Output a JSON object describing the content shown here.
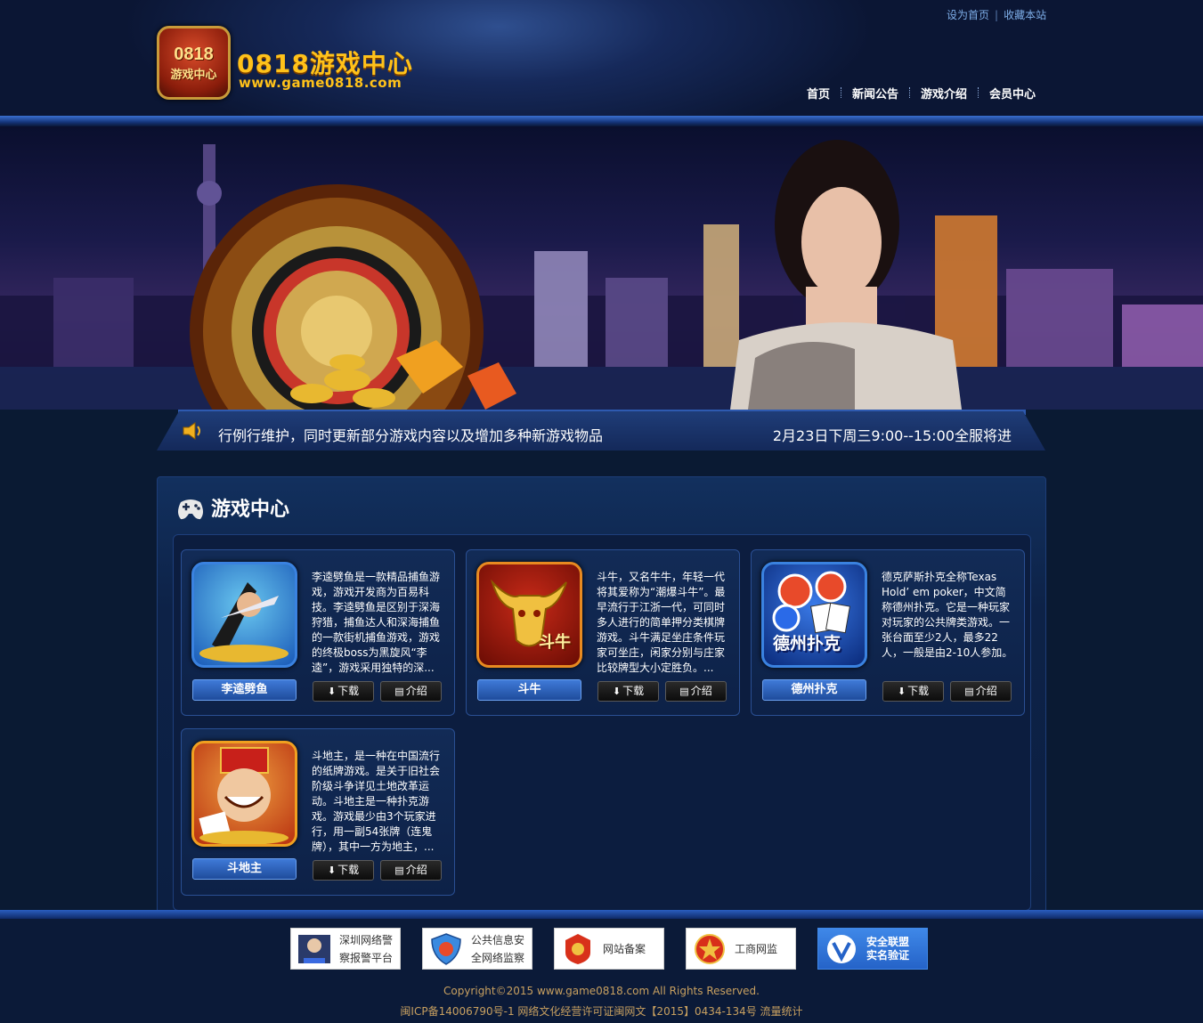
{
  "header": {
    "top_links": [
      "设为首页",
      "收藏本站"
    ],
    "logo_badge_line1": "0818",
    "logo_badge_line2": "游戏中心",
    "logo_title": "0818游戏中心",
    "logo_url": "www.game0818.com",
    "nav": [
      "首页",
      "新闻公告",
      "游戏介绍",
      "会员中心"
    ]
  },
  "notice": {
    "message": "行例行维护，同时更新部分游戏内容以及增加多种新游戏物品",
    "time": "2月23日下周三9:00--15:00全服将进"
  },
  "games_section": {
    "title": "游戏中心",
    "download_label": "下载",
    "intro_label": "介绍",
    "games": [
      {
        "name": "李逵劈鱼",
        "description": "李逵劈鱼是一款精品捕鱼游戏，游戏开发商为百易科技。李逵劈鱼是区别于深海狩猎，捕鱼达人和深海捕鱼的一款街机捕鱼游戏，游戏的终极boss为黑旋风“李逵”，游戏采用独特的深...",
        "thumb_color": "#2a6ad0"
      },
      {
        "name": "斗牛",
        "description": "斗牛，又名牛牛，年轻一代将其爱称为“潮爆斗牛”。最早流行于江浙一代，可同时多人进行的简单押分类棋牌游戏。斗牛满足坐庄条件玩家可坐庄，闲家分别与庄家比较牌型大小定胜负。...",
        "thumb_color": "#8a1408",
        "thumb_text": "斗牛"
      },
      {
        "name": "德州扑克",
        "description": "德克萨斯扑克全称Texas Hold’ em poker，中文简称德州扑克。它是一种玩家对玩家的公共牌类游戏。一张台面至少2人，最多22人，一般是由2-10人参加。",
        "thumb_color": "#0f3aa0",
        "thumb_text": "德州扑克"
      },
      {
        "name": "斗地主",
        "description": "斗地主，是一种在中国流行的纸牌游戏。是关于旧社会阶级斗争详见土地改革运动。斗地主是一种扑克游戏。游戏最少由3个玩家进行，用一副54张牌（连鬼牌），其中一方为地主，...",
        "thumb_color": "#c83010"
      }
    ]
  },
  "footer": {
    "badges": [
      {
        "line1": "深圳网络警",
        "line2": "察报警平台"
      },
      {
        "line1": "公共信息安",
        "line2": "全网络监察"
      },
      {
        "line1": "网站备案",
        "line2": ""
      },
      {
        "line1": "工商网监",
        "line2": ""
      },
      {
        "line1": "安全联盟",
        "line2": "实名验证"
      }
    ],
    "copyright": "Copyright©2015 www.game0818.com All Rights Reserved.",
    "icp": "闽ICP备14006790号-1 网络文化经营许可证闽网文【2015】0434-134号 流量统计"
  }
}
